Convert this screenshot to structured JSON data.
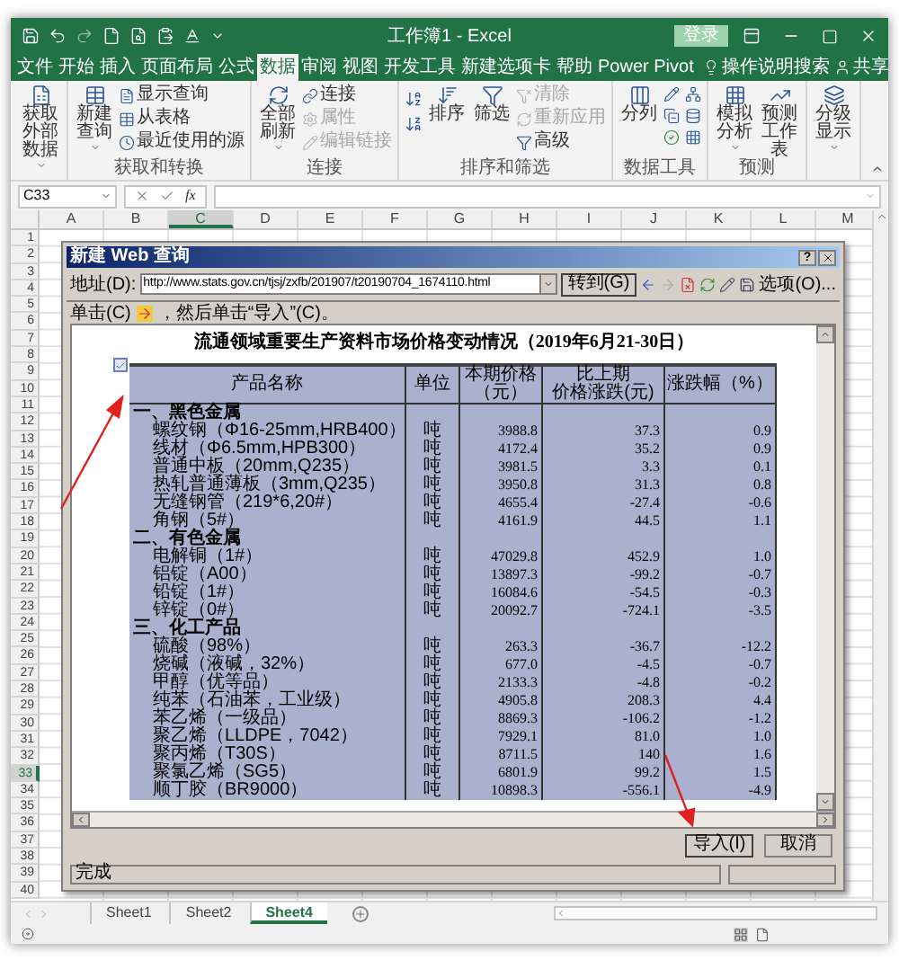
{
  "window": {
    "title": "工作簿1 - Excel",
    "sign_in": "登录"
  },
  "tabs": [
    {
      "label": "文件",
      "selected": false
    },
    {
      "label": "开始",
      "selected": false
    },
    {
      "label": "插入",
      "selected": false
    },
    {
      "label": "页面布局",
      "selected": false
    },
    {
      "label": "公式",
      "selected": false
    },
    {
      "label": "数据",
      "selected": true
    },
    {
      "label": "审阅",
      "selected": false
    },
    {
      "label": "视图",
      "selected": false
    },
    {
      "label": "开发工具",
      "selected": false
    },
    {
      "label": "新建选项卡",
      "selected": false
    },
    {
      "label": "帮助",
      "selected": false
    },
    {
      "label": "Power Pivot",
      "selected": false
    }
  ],
  "tell_me": "操作说明搜索",
  "share": "共享",
  "ribbon_groups": [
    {
      "large": [
        {
          "label": "获取外部数据",
          "dropdown": true
        }
      ]
    },
    {
      "label": "获取和转换",
      "large": [
        {
          "label": "新建查询",
          "dropdown": true
        }
      ],
      "small": [
        {
          "label": "显示查询",
          "disabled": false
        },
        {
          "label": "从表格",
          "disabled": false
        },
        {
          "label": "最近使用的源",
          "disabled": false
        }
      ]
    },
    {
      "label": "连接",
      "large": [
        {
          "label": "全部刷新",
          "dropdown": true
        }
      ],
      "small": [
        {
          "label": "连接",
          "disabled": false
        },
        {
          "label": "属性",
          "disabled": true
        },
        {
          "label": "编辑链接",
          "disabled": true
        }
      ]
    },
    {
      "label": "排序和筛选",
      "large": [
        {
          "label": "排序",
          "dropdown": false
        },
        {
          "label": "筛选",
          "dropdown": false
        }
      ],
      "small": [
        {
          "label": "清除",
          "disabled": true
        },
        {
          "label": "重新应用",
          "disabled": true
        },
        {
          "label": "高级",
          "disabled": false
        }
      ]
    },
    {
      "label": "数据工具",
      "large": [
        {
          "label": "分列",
          "dropdown": false
        }
      ]
    },
    {
      "label": "预测",
      "large": [
        {
          "label": "模拟分析",
          "dropdown": true
        },
        {
          "label": "预测工作表",
          "dropdown": false
        }
      ]
    },
    {
      "large": [
        {
          "label": "分级显示",
          "dropdown": true
        }
      ]
    }
  ],
  "formula_bar": {
    "name_box": "C33",
    "function_label": "fx"
  },
  "sheet": {
    "columns": [
      {
        "label": "A",
        "selected": false
      },
      {
        "label": "B",
        "selected": false
      },
      {
        "label": "C",
        "selected": true
      },
      {
        "label": "D",
        "selected": false
      },
      {
        "label": "E",
        "selected": false
      },
      {
        "label": "F",
        "selected": false
      },
      {
        "label": "G",
        "selected": false
      },
      {
        "label": "H",
        "selected": false
      },
      {
        "label": "I",
        "selected": false
      },
      {
        "label": "J",
        "selected": false
      },
      {
        "label": "K",
        "selected": false
      },
      {
        "label": "L",
        "selected": false
      },
      {
        "label": "M",
        "selected": false
      }
    ],
    "rows": [
      {
        "label": "1",
        "selected": false
      },
      {
        "label": "2",
        "selected": false
      },
      {
        "label": "3",
        "selected": false
      },
      {
        "label": "4",
        "selected": false
      },
      {
        "label": "5",
        "selected": false
      },
      {
        "label": "6",
        "selected": false
      },
      {
        "label": "7",
        "selected": false
      },
      {
        "label": "8",
        "selected": false
      },
      {
        "label": "9",
        "selected": false
      },
      {
        "label": "10",
        "selected": false
      },
      {
        "label": "11",
        "selected": false
      },
      {
        "label": "12",
        "selected": false
      },
      {
        "label": "13",
        "selected": false
      },
      {
        "label": "14",
        "selected": false
      },
      {
        "label": "15",
        "selected": false
      },
      {
        "label": "16",
        "selected": false
      },
      {
        "label": "17",
        "selected": false
      },
      {
        "label": "18",
        "selected": false
      },
      {
        "label": "19",
        "selected": false
      },
      {
        "label": "20",
        "selected": false
      },
      {
        "label": "21",
        "selected": false
      },
      {
        "label": "22",
        "selected": false
      },
      {
        "label": "23",
        "selected": false
      },
      {
        "label": "24",
        "selected": false
      },
      {
        "label": "25",
        "selected": false
      },
      {
        "label": "26",
        "selected": false
      },
      {
        "label": "27",
        "selected": false
      },
      {
        "label": "28",
        "selected": false
      },
      {
        "label": "29",
        "selected": false
      },
      {
        "label": "30",
        "selected": false
      },
      {
        "label": "31",
        "selected": false
      },
      {
        "label": "32",
        "selected": false
      },
      {
        "label": "33",
        "selected": true
      },
      {
        "label": "34",
        "selected": false
      },
      {
        "label": "35",
        "selected": false
      },
      {
        "label": "36",
        "selected": false
      },
      {
        "label": "37",
        "selected": false
      },
      {
        "label": "38",
        "selected": false
      },
      {
        "label": "39",
        "selected": false
      },
      {
        "label": "40",
        "selected": false
      }
    ]
  },
  "sheet_tabs": [
    {
      "label": "Sheet1",
      "selected": false
    },
    {
      "label": "Sheet2",
      "selected": false
    },
    {
      "label": "Sheet4",
      "selected": true
    }
  ],
  "dialog": {
    "title": "新建 Web 查询",
    "help_button": "?",
    "address_label": "地址(D):",
    "url": "http://www.stats.gov.cn/tjsj/zxfb/201907/t20190704_1674110.html",
    "go_button": "转到(G)",
    "options_button": "选项(O)...",
    "hint_before": "单击(C)",
    "hint_after": "，然后单击“导入”(C)。",
    "page": {
      "title": "流通领域重要生产资料市场价格变动情况（2019年6月21-30日）",
      "table": {
        "checked": true,
        "columns": [
          [
            "产品名称"
          ],
          [
            "单位"
          ],
          [
            "本期价格",
            "（元）"
          ],
          [
            "比上期",
            "价格涨跌(元)"
          ],
          [
            "涨跌幅（%）"
          ]
        ],
        "rows": [
          {
            "kind": "category",
            "name": "一、黑色金属"
          },
          {
            "kind": "item",
            "name": "螺纹钢（Φ16-25mm,HRB400）",
            "unit": "吨",
            "price": "3988.8",
            "change": "37.3",
            "pct": "0.9"
          },
          {
            "kind": "item",
            "name": "线材（Φ6.5mm,HPB300）",
            "unit": "吨",
            "price": "4172.4",
            "change": "35.2",
            "pct": "0.9"
          },
          {
            "kind": "item",
            "name": "普通中板（20mm,Q235）",
            "unit": "吨",
            "price": "3981.5",
            "change": "3.3",
            "pct": "0.1"
          },
          {
            "kind": "item",
            "name": "热轧普通薄板（3mm,Q235）",
            "unit": "吨",
            "price": "3950.8",
            "change": "31.3",
            "pct": "0.8"
          },
          {
            "kind": "item",
            "name": "无缝钢管（219*6,20#）",
            "unit": "吨",
            "price": "4655.4",
            "change": "-27.4",
            "pct": "-0.6"
          },
          {
            "kind": "item",
            "name": "角钢（5#）",
            "unit": "吨",
            "price": "4161.9",
            "change": "44.5",
            "pct": "1.1"
          },
          {
            "kind": "category",
            "name": "二、有色金属"
          },
          {
            "kind": "item",
            "name": "电解铜（1#）",
            "unit": "吨",
            "price": "47029.8",
            "change": "452.9",
            "pct": "1.0"
          },
          {
            "kind": "item",
            "name": "铝锭（A00）",
            "unit": "吨",
            "price": "13897.3",
            "change": "-99.2",
            "pct": "-0.7"
          },
          {
            "kind": "item",
            "name": "铅锭（1#）",
            "unit": "吨",
            "price": "16084.6",
            "change": "-54.5",
            "pct": "-0.3"
          },
          {
            "kind": "item",
            "name": "锌锭（0#）",
            "unit": "吨",
            "price": "20092.7",
            "change": "-724.1",
            "pct": "-3.5"
          },
          {
            "kind": "category",
            "name": "三、化工产品"
          },
          {
            "kind": "item",
            "name": "硫酸（98%）",
            "unit": "吨",
            "price": "263.3",
            "change": "-36.7",
            "pct": "-12.2"
          },
          {
            "kind": "item",
            "name": "烧碱（液碱，32%）",
            "unit": "吨",
            "price": "677.0",
            "change": "-4.5",
            "pct": "-0.7"
          },
          {
            "kind": "item",
            "name": "甲醇（优等品）",
            "unit": "吨",
            "price": "2133.3",
            "change": "-4.8",
            "pct": "-0.2"
          },
          {
            "kind": "item",
            "name": "纯苯（石油苯，工业级）",
            "unit": "吨",
            "price": "4905.8",
            "change": "208.3",
            "pct": "4.4"
          },
          {
            "kind": "item",
            "name": "苯乙烯（一级品）",
            "unit": "吨",
            "price": "8869.3",
            "change": "-106.2",
            "pct": "-1.2"
          },
          {
            "kind": "item",
            "name": "聚乙烯（LLDPE，7042）",
            "unit": "吨",
            "price": "7929.1",
            "change": "81.0",
            "pct": "1.0"
          },
          {
            "kind": "item",
            "name": "聚丙烯（T30S）",
            "unit": "吨",
            "price": "8711.5",
            "change": "140",
            "pct": "1.6"
          },
          {
            "kind": "item",
            "name": "聚氯乙烯（SG5）",
            "unit": "吨",
            "price": "6801.9",
            "change": "99.2",
            "pct": "1.5"
          },
          {
            "kind": "item",
            "name": "顺丁胶（BR9000）",
            "unit": "吨",
            "price": "10898.3",
            "change": "-556.1",
            "pct": "-4.9"
          }
        ]
      }
    },
    "import_button": "导入(I)",
    "cancel_button": "取消",
    "status": "完成"
  }
}
